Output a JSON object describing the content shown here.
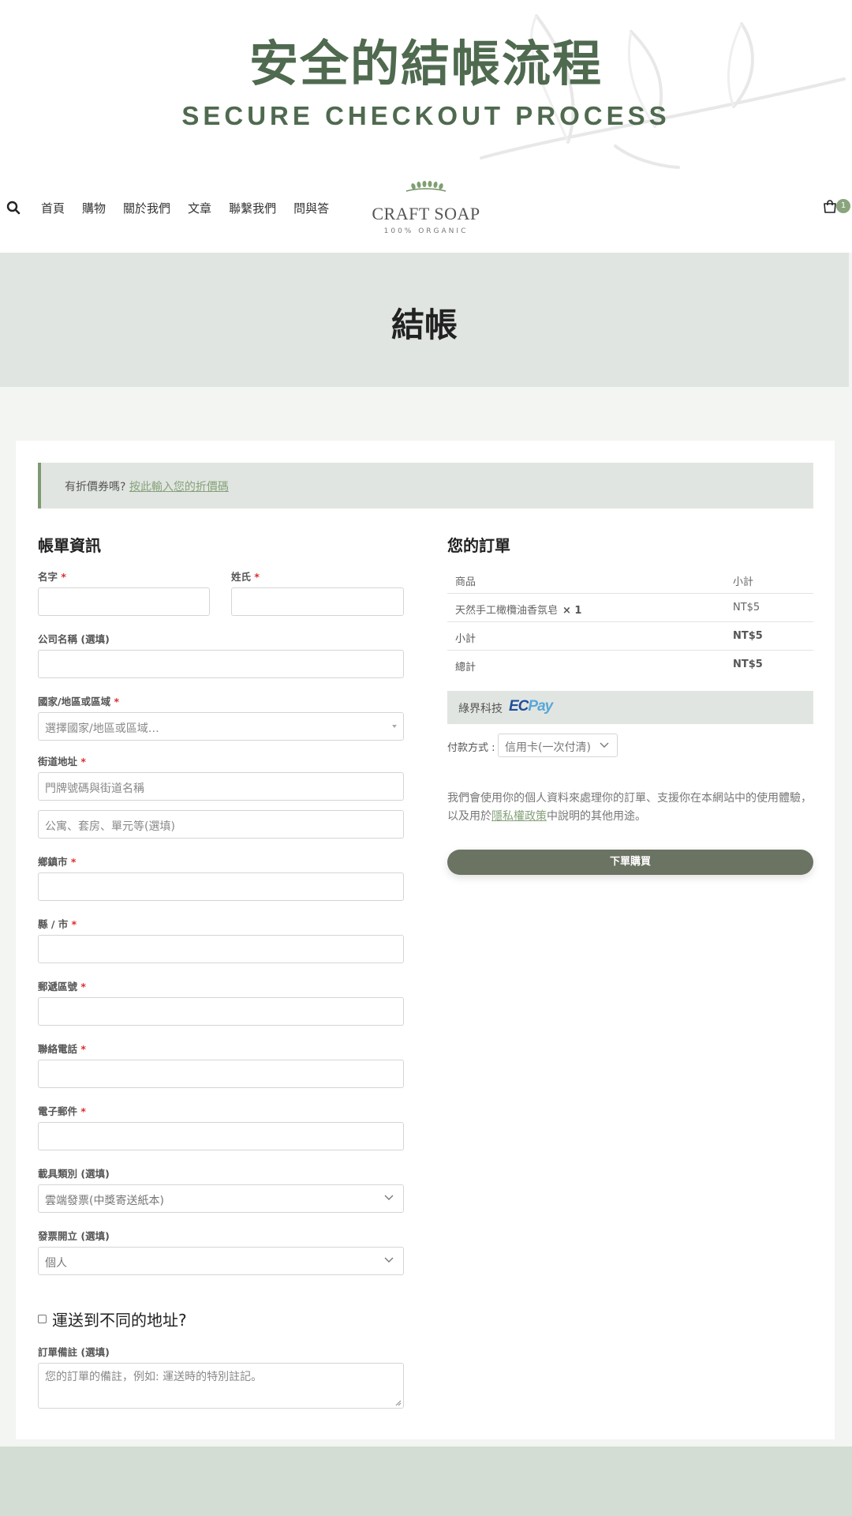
{
  "hero": {
    "title_zh": "安全的結帳流程",
    "title_en": "SECURE CHECKOUT PROCESS"
  },
  "header": {
    "nav": [
      "首頁",
      "購物",
      "關於我們",
      "文章",
      "聯繫我們",
      "問與答"
    ],
    "logo_name": "CRAFT SOAP",
    "logo_tagline": "100% ORGANIC",
    "cart_count": "1"
  },
  "page": {
    "title": "結帳"
  },
  "coupon": {
    "text": "有折價券嗎?",
    "link": "按此輸入您的折價碼"
  },
  "billing": {
    "heading": "帳單資訊",
    "first_name": "名字",
    "last_name": "姓氏",
    "company": "公司名稱 (選填)",
    "country": "國家/地區或區域",
    "country_placeholder": "選擇國家/地區或區域…",
    "street": "街道地址",
    "street_placeholder": "門牌號碼與街道名稱",
    "street2_placeholder": "公寓、套房、單元等(選填)",
    "town": "鄉鎮市",
    "county": "縣 / 市",
    "postcode": "郵遞區號",
    "phone": "聯絡電話",
    "email": "電子郵件",
    "carrier": "載具類別 (選填)",
    "carrier_value": "雲端發票(中獎寄送紙本)",
    "invoice": "發票開立 (選填)",
    "invoice_value": "個人",
    "required_mark": "*"
  },
  "shipping": {
    "ship_different": "運送到不同的地址?",
    "notes_label": "訂單備註 (選填)",
    "notes_placeholder": "您的訂單的備註，例如: 運送時的特別註記。"
  },
  "order": {
    "heading": "您的訂單",
    "col_product": "商品",
    "col_subtotal": "小計",
    "item_name": "天然手工橄欖油香氛皂",
    "item_qty": "× 1",
    "item_price": "NT$5",
    "subtotal_label": "小計",
    "subtotal_value": "NT$5",
    "total_label": "總計",
    "total_value": "NT$5"
  },
  "payment": {
    "provider": "綠界科技",
    "logo_ec": "EC",
    "logo_pay": "Pay",
    "method_label": "付款方式 :",
    "method_value": "信用卡(一次付清)",
    "privacy_before": "我們會使用你的個人資料來處理你的訂單、支援你在本網站中的使用體驗，以及用於",
    "privacy_link": "隱私權政策",
    "privacy_after": "中說明的其他用途。",
    "place_order": "下單購買"
  },
  "colors": {
    "brand_green": "#4f6a4f",
    "accent": "#86a27a",
    "button": "#6b7362",
    "required": "#e02b2b"
  }
}
